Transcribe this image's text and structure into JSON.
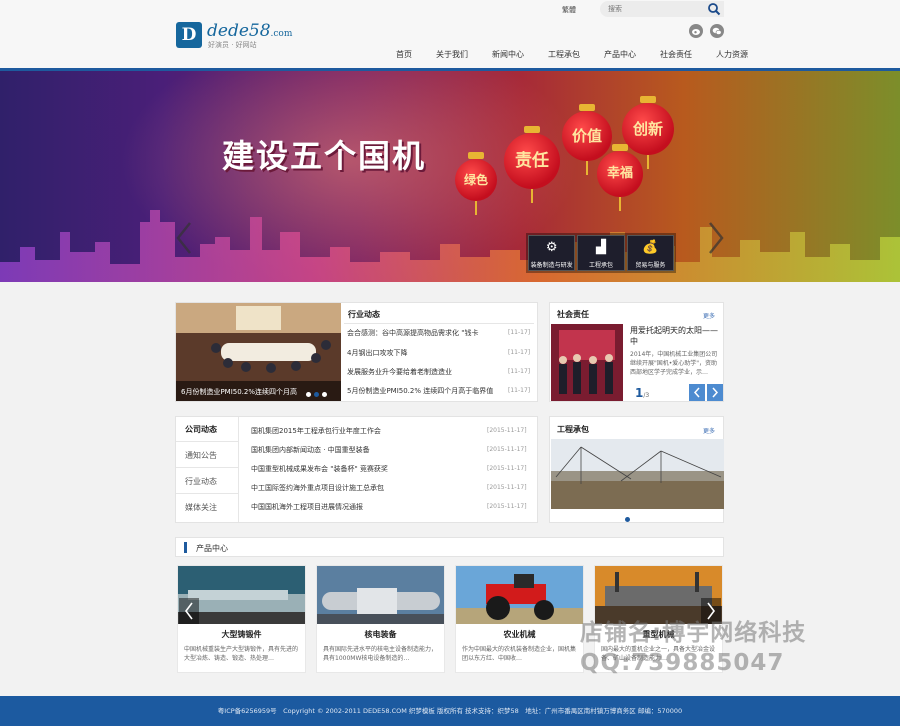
{
  "header": {
    "logo_mark": "D",
    "logo_name": "dede58",
    "logo_domain": ".com",
    "logo_slogan": "好演员 · 好网站",
    "lang_link": "繁體",
    "search_placeholder": "搜索",
    "nav": [
      "首页",
      "关于我们",
      "新闻中心",
      "工程承包",
      "产品中心",
      "社会责任",
      "人力资源"
    ]
  },
  "banner": {
    "slogan": "建设五个国机",
    "lanterns": [
      "绿色",
      "责任",
      "价值",
      "创新",
      "幸福"
    ],
    "tiles": [
      {
        "icon": "gears-icon",
        "label": "装备制造与研发"
      },
      {
        "icon": "factory-icon",
        "label": "工程承包"
      },
      {
        "icon": "money-bag-icon",
        "label": "贸易与服务"
      }
    ]
  },
  "industry_news": {
    "title": "行业动态",
    "photo_caption": "6月份制造业PMI50.2%连续四个月高",
    "items": [
      {
        "text": "会合感测：谷中高源提高物品需求化 \"钱卡",
        "date": "[11-17]"
      },
      {
        "text": "4月钢出口攻攻下降",
        "date": "[11-17]"
      },
      {
        "text": "发展服务业升今要给着老制造造业",
        "date": "[11-17]"
      },
      {
        "text": "5月份制造业PMI50.2% 连续四个月高于临界值",
        "date": "[11-17]"
      }
    ]
  },
  "social_duty": {
    "title": "社会责任",
    "more": "更多",
    "headline": "用爱托起明天的太阳——中",
    "summary": "2014年，中国机械工业集团公司继续开展\"国机•爱心助学\"，资助西部地区学子完成学业，示…",
    "page_current": "1",
    "page_total": "/3"
  },
  "company_news": {
    "tabs": [
      "公司动态",
      "通知公告",
      "行业动态",
      "媒体关注"
    ],
    "items": [
      {
        "text": "国机集团2015年工程承包行业年度工作会",
        "date": "[2015-11-17]"
      },
      {
        "text": "国机集团内部新闻动态 · 中国重型装备",
        "date": "[2015-11-17]"
      },
      {
        "text": "中国重型机械成果发布会 \"装备杯\" 竞赛获奖",
        "date": "[2015-11-17]"
      },
      {
        "text": "中工国际签约海外重点项目设计施工总承包",
        "date": "[2015-11-17]"
      },
      {
        "text": "中国国机海外工程项目进展情况通报",
        "date": "[2015-11-17]"
      }
    ]
  },
  "engineering": {
    "title": "工程承包",
    "more": "更多"
  },
  "products": {
    "title": "产品中心",
    "items": [
      {
        "name": "大型铸锻件",
        "desc": "中国机械重装生产大型铸锻件，具有先进的大型冶炼、铸造、锻造、热处理…"
      },
      {
        "name": "核电装备",
        "desc": "具有国际先进水平的核电主设备制造能力，具有1000MW核电设备制造的…"
      },
      {
        "name": "农业机械",
        "desc": "作为中国最大的农机装备制造企业，国机集团以东方红、中国收…"
      },
      {
        "name": "重型机械",
        "desc": "国内最大的重机企业之一，具备大型冶金设备、矿山设备制造能力…"
      }
    ]
  },
  "footer": {
    "text": "粤ICP备6256959号　Copyright © 2002-2011 DEDE58.COM 织梦模板 版权所有 技术支持：织梦58　地址：广州市番禺区南村镇万博商务区 邮编：570000"
  },
  "watermark": {
    "line1": "店铺名:博宇网络科技",
    "line2": "QQ:739885047"
  },
  "colors": {
    "brand_blue": "#1e5a9e",
    "lantern_red": "#c40e1e"
  }
}
